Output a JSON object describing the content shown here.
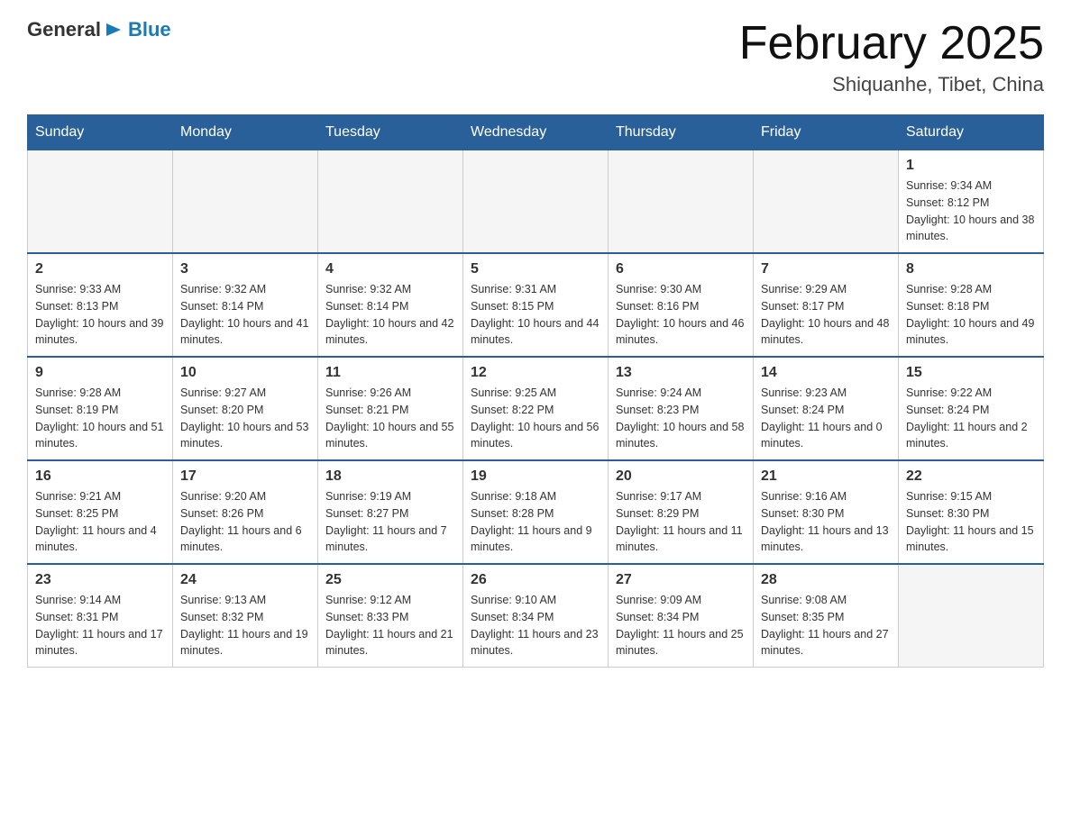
{
  "header": {
    "logo": {
      "general": "General",
      "arrow_symbol": "▶",
      "blue": "Blue"
    },
    "title": "February 2025",
    "location": "Shiquanhe, Tibet, China"
  },
  "days_of_week": [
    "Sunday",
    "Monday",
    "Tuesday",
    "Wednesday",
    "Thursday",
    "Friday",
    "Saturday"
  ],
  "weeks": [
    [
      {
        "day": "",
        "empty": true
      },
      {
        "day": "",
        "empty": true
      },
      {
        "day": "",
        "empty": true
      },
      {
        "day": "",
        "empty": true
      },
      {
        "day": "",
        "empty": true
      },
      {
        "day": "",
        "empty": true
      },
      {
        "day": "1",
        "sunrise": "9:34 AM",
        "sunset": "8:12 PM",
        "daylight": "10 hours and 38 minutes."
      }
    ],
    [
      {
        "day": "2",
        "sunrise": "9:33 AM",
        "sunset": "8:13 PM",
        "daylight": "10 hours and 39 minutes."
      },
      {
        "day": "3",
        "sunrise": "9:32 AM",
        "sunset": "8:14 PM",
        "daylight": "10 hours and 41 minutes."
      },
      {
        "day": "4",
        "sunrise": "9:32 AM",
        "sunset": "8:14 PM",
        "daylight": "10 hours and 42 minutes."
      },
      {
        "day": "5",
        "sunrise": "9:31 AM",
        "sunset": "8:15 PM",
        "daylight": "10 hours and 44 minutes."
      },
      {
        "day": "6",
        "sunrise": "9:30 AM",
        "sunset": "8:16 PM",
        "daylight": "10 hours and 46 minutes."
      },
      {
        "day": "7",
        "sunrise": "9:29 AM",
        "sunset": "8:17 PM",
        "daylight": "10 hours and 48 minutes."
      },
      {
        "day": "8",
        "sunrise": "9:28 AM",
        "sunset": "8:18 PM",
        "daylight": "10 hours and 49 minutes."
      }
    ],
    [
      {
        "day": "9",
        "sunrise": "9:28 AM",
        "sunset": "8:19 PM",
        "daylight": "10 hours and 51 minutes."
      },
      {
        "day": "10",
        "sunrise": "9:27 AM",
        "sunset": "8:20 PM",
        "daylight": "10 hours and 53 minutes."
      },
      {
        "day": "11",
        "sunrise": "9:26 AM",
        "sunset": "8:21 PM",
        "daylight": "10 hours and 55 minutes."
      },
      {
        "day": "12",
        "sunrise": "9:25 AM",
        "sunset": "8:22 PM",
        "daylight": "10 hours and 56 minutes."
      },
      {
        "day": "13",
        "sunrise": "9:24 AM",
        "sunset": "8:23 PM",
        "daylight": "10 hours and 58 minutes."
      },
      {
        "day": "14",
        "sunrise": "9:23 AM",
        "sunset": "8:24 PM",
        "daylight": "11 hours and 0 minutes."
      },
      {
        "day": "15",
        "sunrise": "9:22 AM",
        "sunset": "8:24 PM",
        "daylight": "11 hours and 2 minutes."
      }
    ],
    [
      {
        "day": "16",
        "sunrise": "9:21 AM",
        "sunset": "8:25 PM",
        "daylight": "11 hours and 4 minutes."
      },
      {
        "day": "17",
        "sunrise": "9:20 AM",
        "sunset": "8:26 PM",
        "daylight": "11 hours and 6 minutes."
      },
      {
        "day": "18",
        "sunrise": "9:19 AM",
        "sunset": "8:27 PM",
        "daylight": "11 hours and 7 minutes."
      },
      {
        "day": "19",
        "sunrise": "9:18 AM",
        "sunset": "8:28 PM",
        "daylight": "11 hours and 9 minutes."
      },
      {
        "day": "20",
        "sunrise": "9:17 AM",
        "sunset": "8:29 PM",
        "daylight": "11 hours and 11 minutes."
      },
      {
        "day": "21",
        "sunrise": "9:16 AM",
        "sunset": "8:30 PM",
        "daylight": "11 hours and 13 minutes."
      },
      {
        "day": "22",
        "sunrise": "9:15 AM",
        "sunset": "8:30 PM",
        "daylight": "11 hours and 15 minutes."
      }
    ],
    [
      {
        "day": "23",
        "sunrise": "9:14 AM",
        "sunset": "8:31 PM",
        "daylight": "11 hours and 17 minutes."
      },
      {
        "day": "24",
        "sunrise": "9:13 AM",
        "sunset": "8:32 PM",
        "daylight": "11 hours and 19 minutes."
      },
      {
        "day": "25",
        "sunrise": "9:12 AM",
        "sunset": "8:33 PM",
        "daylight": "11 hours and 21 minutes."
      },
      {
        "day": "26",
        "sunrise": "9:10 AM",
        "sunset": "8:34 PM",
        "daylight": "11 hours and 23 minutes."
      },
      {
        "day": "27",
        "sunrise": "9:09 AM",
        "sunset": "8:34 PM",
        "daylight": "11 hours and 25 minutes."
      },
      {
        "day": "28",
        "sunrise": "9:08 AM",
        "sunset": "8:35 PM",
        "daylight": "11 hours and 27 minutes."
      },
      {
        "day": "",
        "empty": true
      }
    ]
  ]
}
